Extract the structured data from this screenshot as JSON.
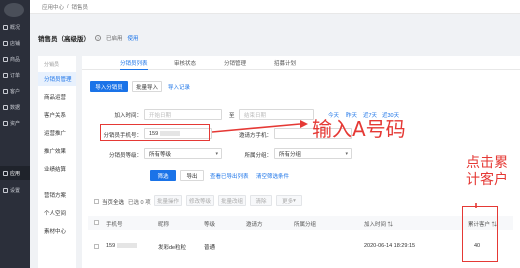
{
  "nav": {
    "items": [
      {
        "label": "概况",
        "icon": "home-icon"
      },
      {
        "label": "店铺",
        "icon": "shop-icon"
      },
      {
        "label": "商品",
        "icon": "goods-icon"
      },
      {
        "label": "订单",
        "icon": "order-icon"
      },
      {
        "label": "客户",
        "icon": "user-icon"
      },
      {
        "label": "数据",
        "icon": "chart-icon"
      },
      {
        "label": "资产",
        "icon": "wallet-icon"
      },
      {
        "label": "应用",
        "icon": "apps-icon"
      },
      {
        "label": "设置",
        "icon": "gear-icon"
      }
    ]
  },
  "breadcrumb": {
    "parent": "应用中心",
    "sep": "/",
    "current": "销售员"
  },
  "page": {
    "title": "销售员（高级版）",
    "status": "已启用",
    "link": "使用"
  },
  "side": {
    "group": "分销员",
    "items": [
      "分销员管理",
      "商品运营",
      "客户关系",
      "运营推广",
      "推广效果",
      "业绩结算",
      "营销方案",
      "个人空间",
      "素材中心"
    ]
  },
  "tabs": [
    "分销员列表",
    "审核状态",
    "分销管理",
    "招募计划"
  ],
  "toolbar": {
    "add": "导入分销员",
    "batch": "批量导入",
    "record": "导入记录"
  },
  "filter": {
    "join_time_label": "加入时间：",
    "start_placeholder": "开始日期",
    "to": "至",
    "end_placeholder": "结束日期",
    "today": "今天",
    "yesterday": "昨天",
    "last7": "近7天",
    "last30": "近30天",
    "phone_label": "分销员手机号：",
    "phone_value": "159",
    "inviter_label": "邀请方手机：",
    "level_label": "分销员等级：",
    "level_value": "所有等级",
    "group_label": "所属分组：",
    "group_value": "所有分组",
    "filter_btn": "筛选",
    "export_btn": "导出",
    "view_export": "查看已导出列表",
    "clear": "清空筛选条件"
  },
  "bulk": {
    "select_all": "当页全选",
    "selected": "已选 0 项",
    "batch_ops": "批量操作",
    "modify_level": "修改等级",
    "modify_group": "批量改组",
    "clear": "清除",
    "more": "更多"
  },
  "table": {
    "headers": [
      "手机号",
      "昵称",
      "等级",
      "邀请方",
      "所属分组",
      "加入时间",
      "累计客户"
    ],
    "rows": [
      {
        "phone": "159",
        "nickname": "发彩de粒粒",
        "level": "普通",
        "inviter": "",
        "group": "",
        "join_time": "2020-06-14 18:29:15",
        "customers": "40"
      }
    ]
  },
  "annotations": {
    "input_hint": "输入A号码",
    "click_hint": "点击累计客户"
  },
  "colors": {
    "primary": "#1a73e8",
    "annotation": "#e53935",
    "nav_bg": "#2b2f3a"
  }
}
